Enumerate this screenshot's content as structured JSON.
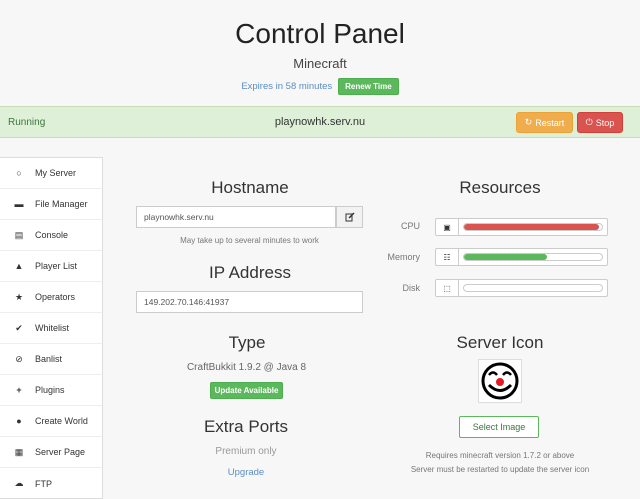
{
  "header": {
    "title": "Control Panel",
    "subtitle": "Minecraft",
    "expires": "Expires in 58 minutes",
    "renew_label": "Renew Time"
  },
  "status": {
    "state": "Running",
    "hostname": "playnowhk.serv.nu",
    "restart_label": "Restart",
    "stop_label": "Stop"
  },
  "sidebar": {
    "items": [
      {
        "label": "My Server",
        "icon": "power-icon"
      },
      {
        "label": "File Manager",
        "icon": "folder-icon"
      },
      {
        "label": "Console",
        "icon": "console-icon"
      },
      {
        "label": "Player List",
        "icon": "user-icon"
      },
      {
        "label": "Operators",
        "icon": "star-icon"
      },
      {
        "label": "Whitelist",
        "icon": "check-icon"
      },
      {
        "label": "Banlist",
        "icon": "ban-icon"
      },
      {
        "label": "Plugins",
        "icon": "plus-icon"
      },
      {
        "label": "Create World",
        "icon": "globe-icon"
      },
      {
        "label": "Server Page",
        "icon": "grid-icon"
      },
      {
        "label": "FTP",
        "icon": "cloud-icon"
      }
    ]
  },
  "hostname_section": {
    "title": "Hostname",
    "value": "playnowhk.serv.nu",
    "help": "May take up to several minutes to work"
  },
  "ip_section": {
    "title": "IP Address",
    "value": "149.202.70.146:41937"
  },
  "type_section": {
    "title": "Type",
    "value": "CraftBukkit 1.9.2 @ Java 8",
    "update_label": "Update Available"
  },
  "ports_section": {
    "title": "Extra Ports",
    "tier": "Premium only",
    "upgrade_label": "Upgrade"
  },
  "resources": {
    "title": "Resources",
    "items": [
      {
        "label": "CPU",
        "fraction": 0.98,
        "color": "#d9534f"
      },
      {
        "label": "Memory",
        "fraction": 0.6,
        "color": "#5cb85c"
      },
      {
        "label": "Disk",
        "fraction": 0.0,
        "color": "#5bc0de"
      }
    ]
  },
  "server_icon": {
    "title": "Server Icon",
    "select_label": "Select Image",
    "note1": "Requires minecraft version 1.7.2 or above",
    "note2": "Server must be restarted to update the server icon"
  }
}
